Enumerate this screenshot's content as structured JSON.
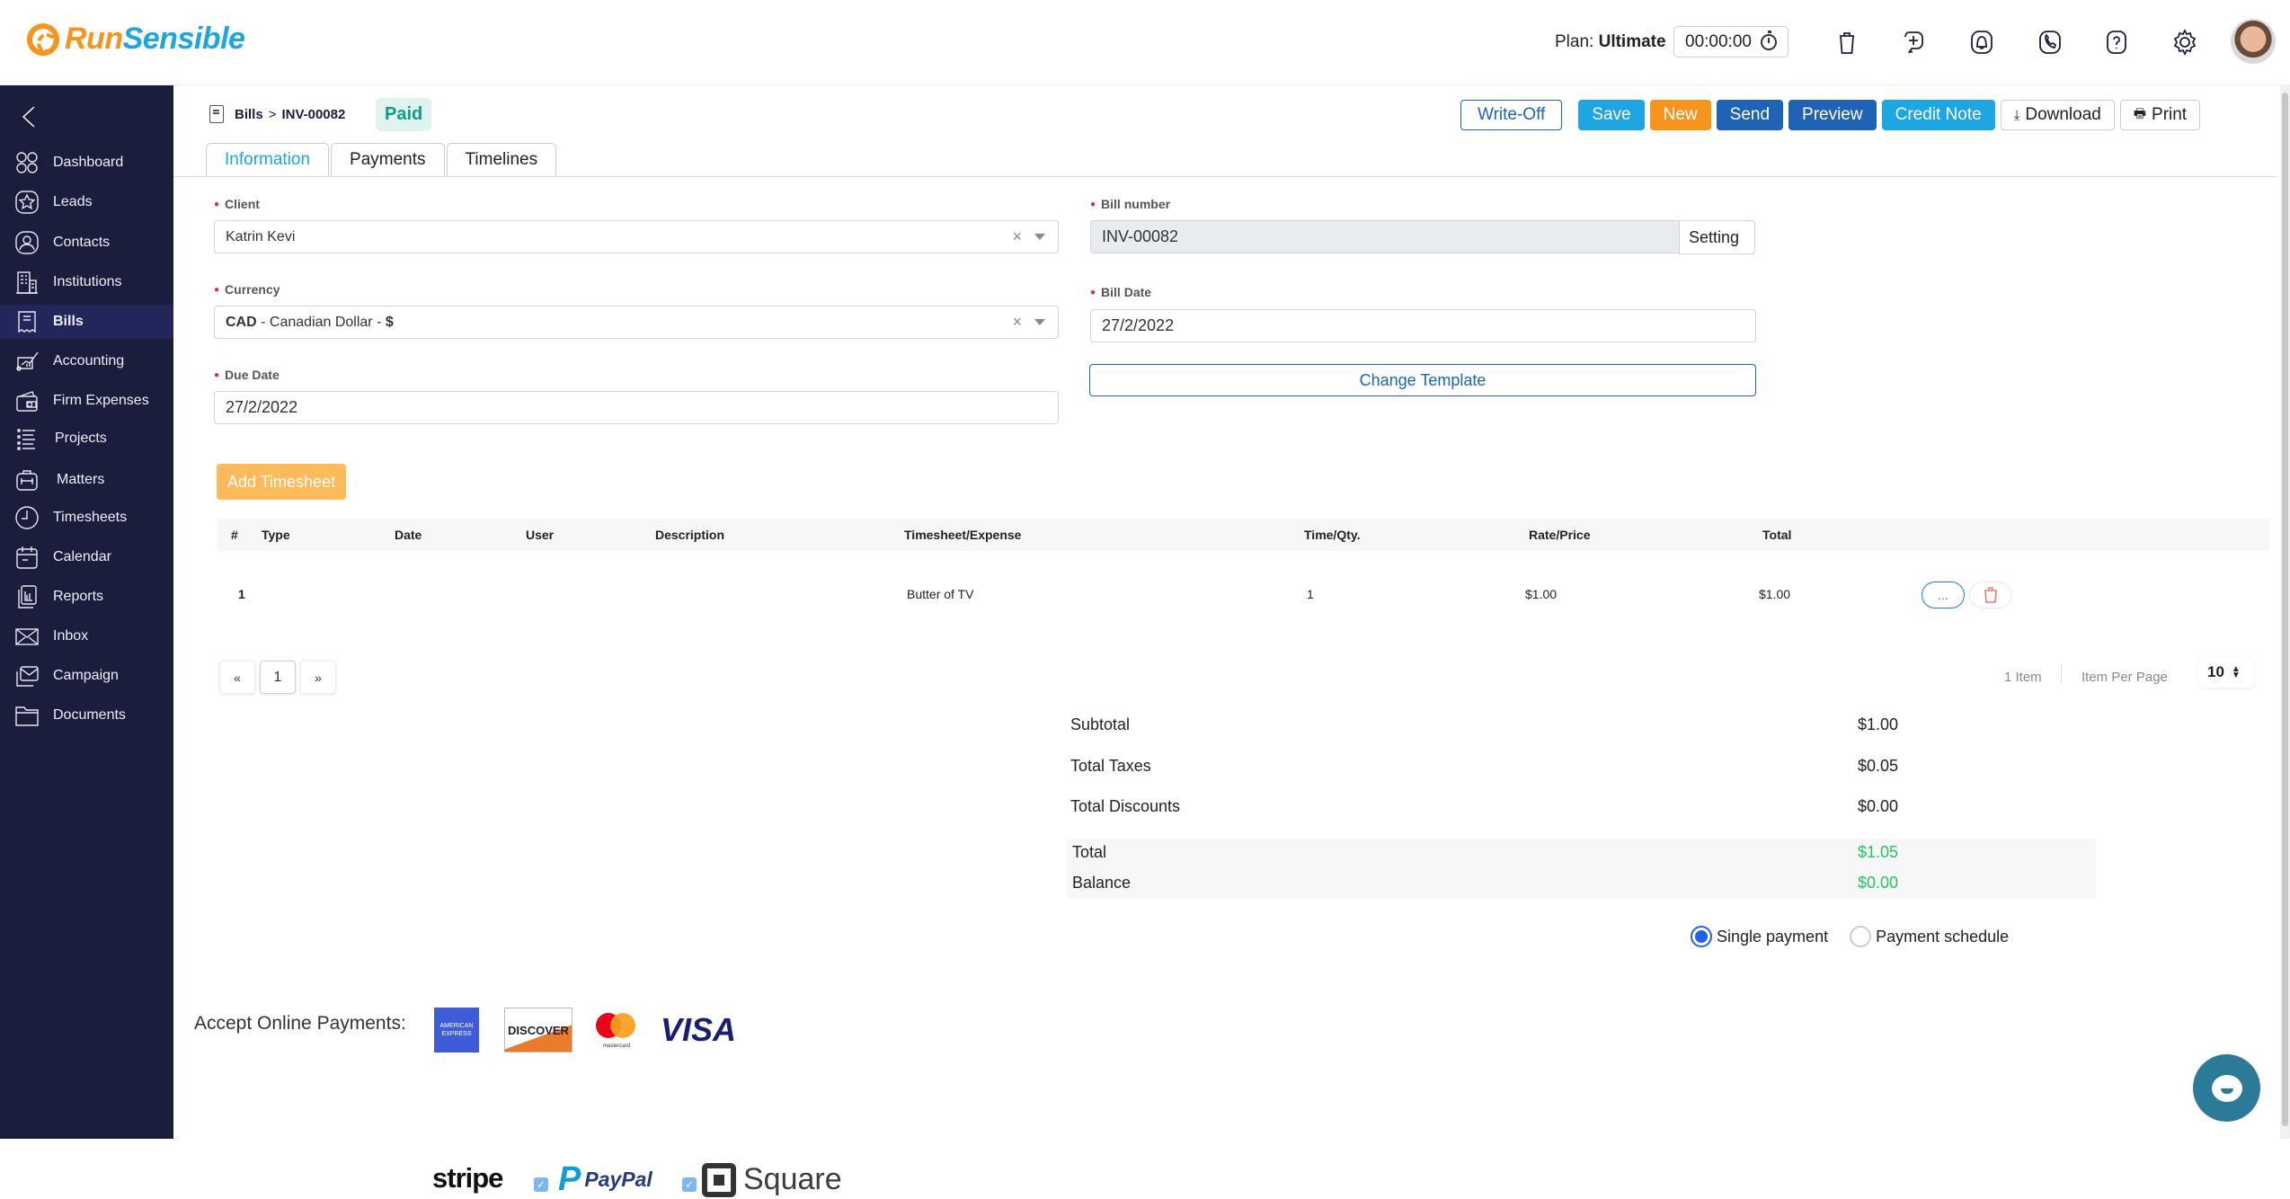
{
  "app": {
    "logo_run": "Run",
    "logo_sensible": "Sensible",
    "plan_label": "Plan:",
    "plan_value": "Ultimate",
    "timer": "00:00:00",
    "brand_colors": {
      "orange": "#f7941d",
      "blue": "#1ea6e3",
      "navy": "#1a1d3c"
    }
  },
  "header_icons": [
    "trash-icon",
    "add-task-icon",
    "notification-bell-icon",
    "phone-icon",
    "help-icon",
    "settings-gear-icon",
    "user-avatar"
  ],
  "sidebar": {
    "items": [
      {
        "label": "Dashboard",
        "icon": "dashboard-icon"
      },
      {
        "label": "Leads",
        "icon": "star-icon"
      },
      {
        "label": "Contacts",
        "icon": "contact-icon"
      },
      {
        "label": "Institutions",
        "icon": "building-icon"
      },
      {
        "label": "Bills",
        "icon": "bill-icon",
        "active": true
      },
      {
        "label": "Accounting",
        "icon": "accounting-icon"
      },
      {
        "label": "Firm Expenses",
        "icon": "wallet-icon"
      },
      {
        "label": "Projects",
        "icon": "list-icon"
      },
      {
        "label": "Matters",
        "icon": "briefcase-icon"
      },
      {
        "label": "Timesheets",
        "icon": "clock-icon"
      },
      {
        "label": "Calendar",
        "icon": "calendar-icon"
      },
      {
        "label": "Reports",
        "icon": "report-icon"
      },
      {
        "label": "Inbox",
        "icon": "mail-icon"
      },
      {
        "label": "Campaign",
        "icon": "campaign-icon"
      },
      {
        "label": "Documents",
        "icon": "folder-icon"
      }
    ]
  },
  "breadcrumb": {
    "root": "Bills",
    "separator": ">",
    "current": "INV-00082"
  },
  "status_badge": "Paid",
  "actions": {
    "write_off": "Write-Off",
    "save": "Save",
    "new": "New",
    "send": "Send",
    "preview": "Preview",
    "credit_note": "Credit Note",
    "download": "Download",
    "print": "Print"
  },
  "tabs": [
    {
      "label": "Information",
      "active": true
    },
    {
      "label": "Payments"
    },
    {
      "label": "Timelines"
    }
  ],
  "form": {
    "client": {
      "label": "Client",
      "value": "Katrin Kevi"
    },
    "currency": {
      "label": "Currency",
      "code": "CAD",
      "name": " - Canadian Dollar - ",
      "symbol": "$"
    },
    "due_date": {
      "label": "Due Date",
      "value": "27/2/2022"
    },
    "bill_number": {
      "label": "Bill number",
      "value": "INV-00082",
      "setting_label": "Setting"
    },
    "bill_date": {
      "label": "Bill Date",
      "value": "27/2/2022"
    },
    "change_template": "Change Template"
  },
  "add_timesheet": "Add Timesheet",
  "table": {
    "columns": [
      "#",
      "Type",
      "Date",
      "User",
      "Description",
      "Timesheet/Expense",
      "Time/Qty.",
      "Rate/Price",
      "Total"
    ],
    "rows": [
      {
        "num": "1",
        "type": "",
        "date": "",
        "user": "",
        "description": "",
        "timesheet": "Butter of TV",
        "qty": "1",
        "rate": "$1.00",
        "total": "$1.00",
        "more": "..."
      }
    ]
  },
  "pagination": {
    "prev": "«",
    "current": "1",
    "next": "»",
    "items_count": "1 Item",
    "per_page_label": "Item Per Page",
    "per_page_value": "10"
  },
  "summary": {
    "subtotal_label": "Subtotal",
    "subtotal": "$1.00",
    "taxes_label": "Total Taxes",
    "taxes": "$0.05",
    "discounts_label": "Total Discounts",
    "discounts": "$0.00",
    "total_label": "Total",
    "total": "$1.05",
    "balance_label": "Balance",
    "balance": "$0.00"
  },
  "payment_type": {
    "single": "Single payment",
    "schedule": "Payment schedule",
    "selected": "single"
  },
  "online_payments": {
    "label": "Accept Online Payments:",
    "cards": [
      "AMERICAN EXPRESS",
      "DISCOVER",
      "mastercard",
      "VISA"
    ],
    "providers": [
      {
        "name": "stripe",
        "checked": null
      },
      {
        "name": "PayPal",
        "checked": true
      },
      {
        "name": "Square",
        "checked": true
      }
    ]
  }
}
